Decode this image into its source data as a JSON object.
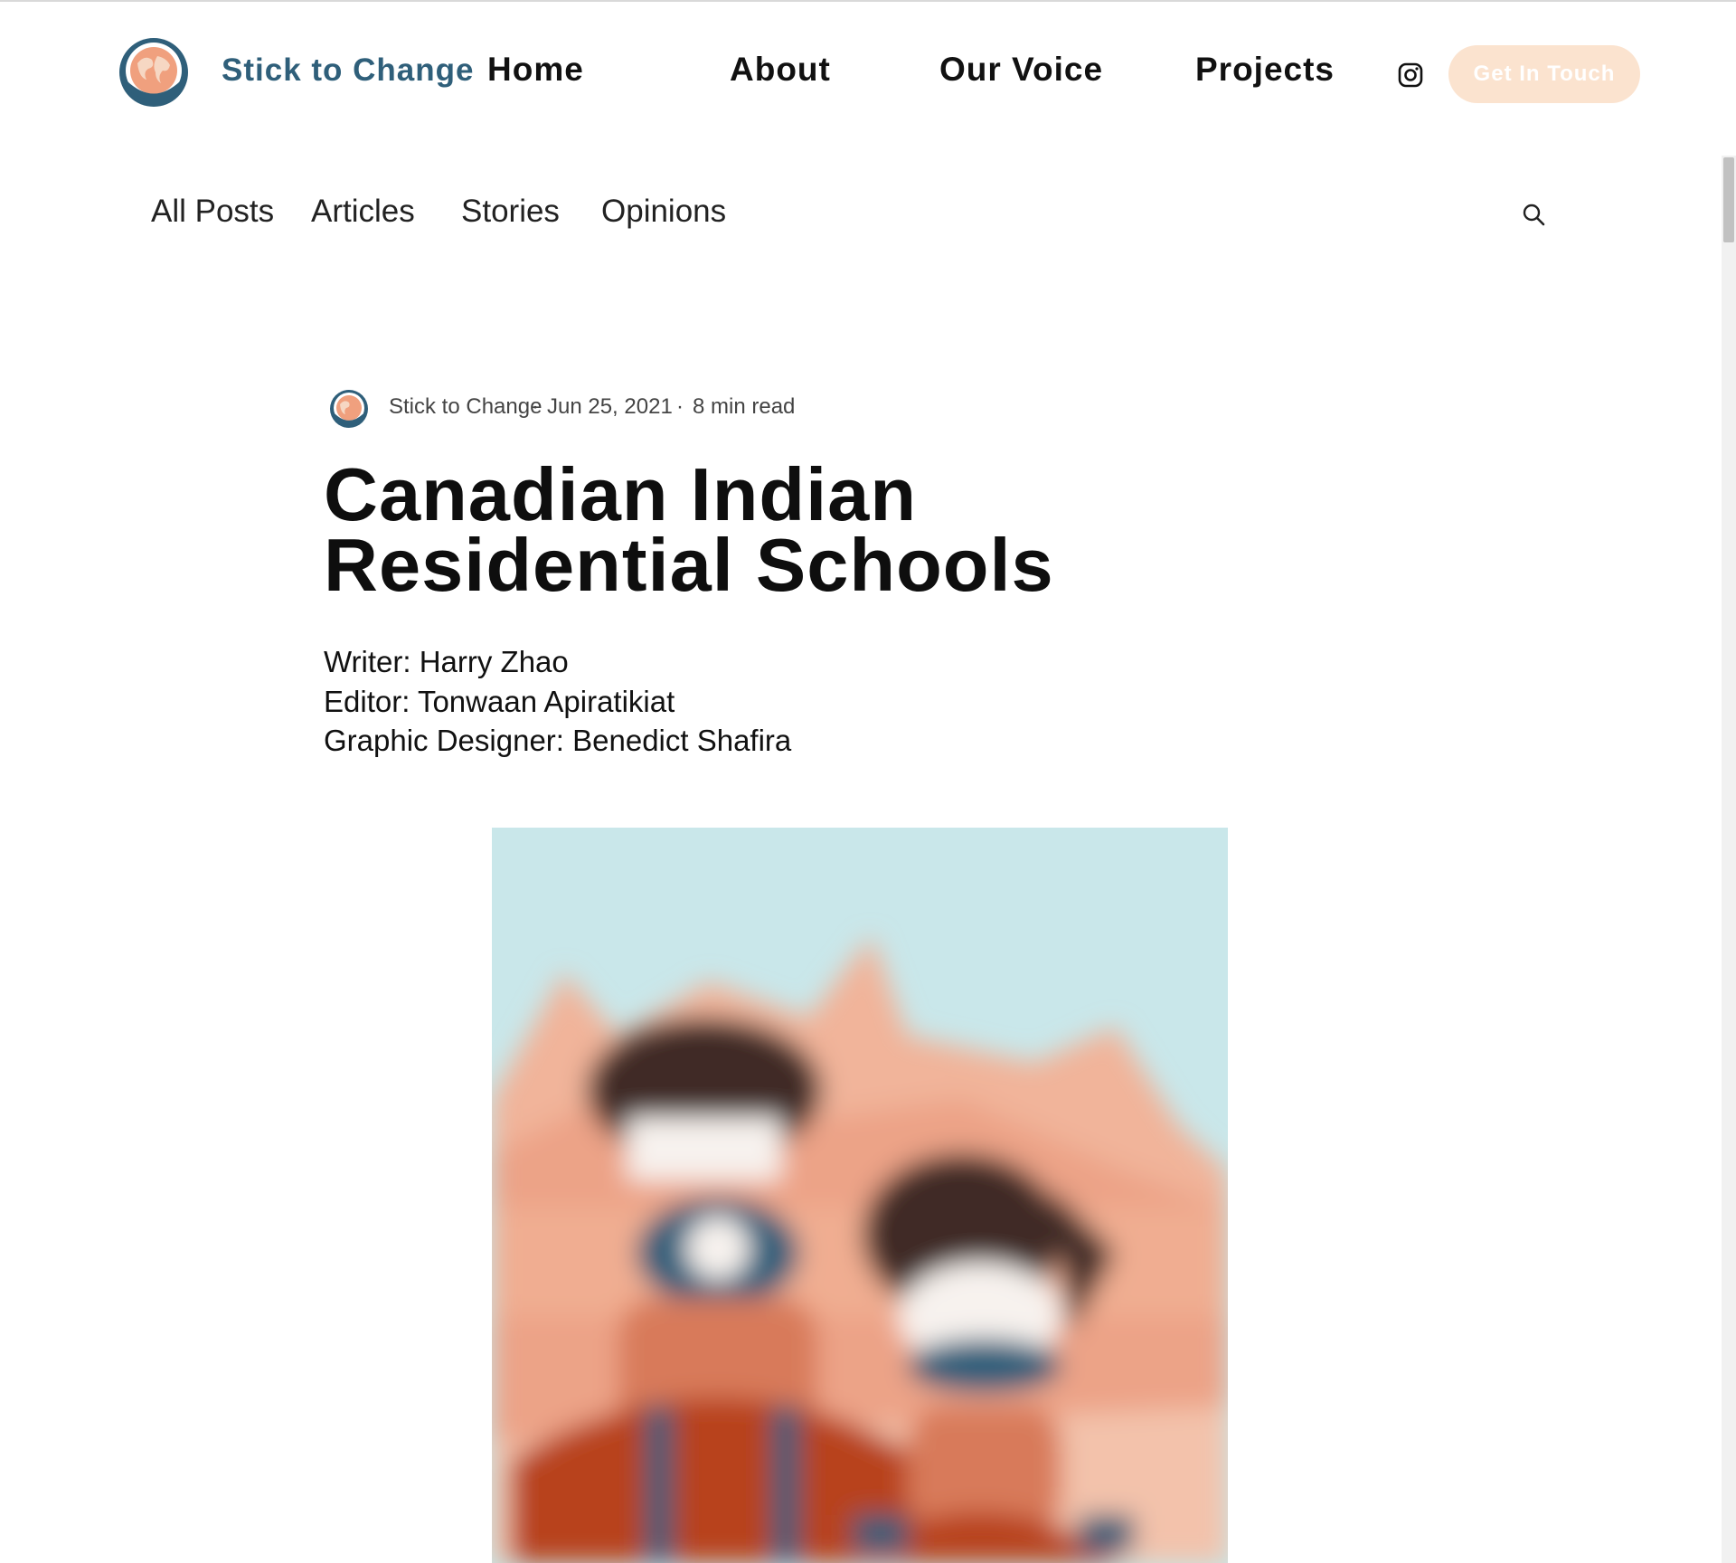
{
  "header": {
    "brand": "Stick to Change",
    "nav": [
      "Home",
      "About",
      "Our Voice",
      "Projects"
    ],
    "cta": "Get In Touch"
  },
  "categories": [
    "All Posts",
    "Articles",
    "Stories",
    "Opinions"
  ],
  "post": {
    "author": "Stick to Change",
    "date": "Jun 25, 2021",
    "read_time": "8 min read",
    "title_line1": "Canadian Indian",
    "title_line2": "Residential Schools",
    "credits": [
      "Writer: Harry Zhao",
      "Editor: Tonwaan Apiratikiat",
      "Graphic Designer: Benedict Shafira"
    ]
  },
  "icons": {
    "logo": "globe-logo-icon",
    "social": "instagram-icon",
    "search": "search-icon"
  },
  "colors": {
    "brand": "#2f5f7a",
    "cta_bg": "#fbe3cf",
    "hero_sky": "#c9e7ea",
    "hero_building": "#efaa8c",
    "hero_accent": "#b8421b"
  }
}
